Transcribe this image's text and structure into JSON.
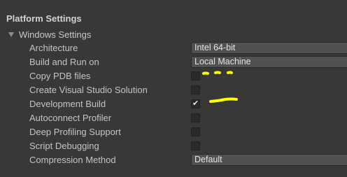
{
  "panel": {
    "title": "Platform Settings",
    "group_label": "Windows Settings",
    "group_expanded": true
  },
  "rows": [
    {
      "label": "Architecture",
      "control": "dropdown",
      "value": "Intel 64-bit"
    },
    {
      "label": "Build and Run on",
      "control": "dropdown",
      "value": "Local Machine"
    },
    {
      "label": "Copy PDB files",
      "control": "checkbox",
      "checked": false
    },
    {
      "label": "Create Visual Studio Solution",
      "control": "checkbox",
      "checked": false
    },
    {
      "label": "Development Build",
      "control": "checkbox",
      "checked": true
    },
    {
      "label": "Autoconnect Profiler",
      "control": "checkbox",
      "checked": false
    },
    {
      "label": "Deep Profiling Support",
      "control": "checkbox",
      "checked": false
    },
    {
      "label": "Script Debugging",
      "control": "checkbox",
      "checked": false
    },
    {
      "label": "Compression Method",
      "control": "dropdown",
      "value": "Default"
    }
  ],
  "icons": {
    "foldout": "chevron-down-icon",
    "check": "checkmark-icon"
  },
  "colors": {
    "background": "#383838",
    "annotation": "#ffff00"
  }
}
